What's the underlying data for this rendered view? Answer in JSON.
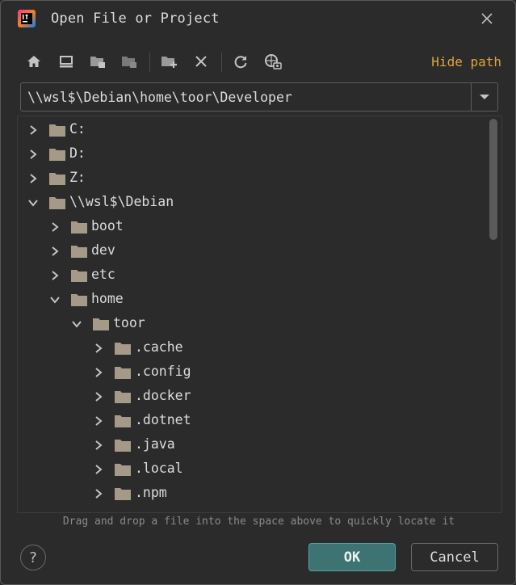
{
  "window": {
    "title": "Open File or Project"
  },
  "toolbar": {
    "buttons": [
      "home-icon",
      "desktop-icon",
      "project-folder-icon",
      "module-folder-icon",
      "new-folder-icon",
      "delete-icon",
      "refresh-icon",
      "show-hidden-icon"
    ],
    "hide_path_label": "Hide path"
  },
  "path": {
    "value": "\\\\wsl$\\Debian\\home\\toor\\Developer"
  },
  "tree": {
    "items": [
      {
        "label": "C:",
        "level": 0,
        "expanded": false
      },
      {
        "label": "D:",
        "level": 0,
        "expanded": false
      },
      {
        "label": "Z:",
        "level": 0,
        "expanded": false
      },
      {
        "label": "\\\\wsl$\\Debian",
        "level": 0,
        "expanded": true
      },
      {
        "label": "boot",
        "level": 1,
        "expanded": false
      },
      {
        "label": "dev",
        "level": 1,
        "expanded": false
      },
      {
        "label": "etc",
        "level": 1,
        "expanded": false
      },
      {
        "label": "home",
        "level": 1,
        "expanded": true
      },
      {
        "label": "toor",
        "level": 2,
        "expanded": true
      },
      {
        "label": ".cache",
        "level": 3,
        "expanded": false
      },
      {
        "label": ".config",
        "level": 3,
        "expanded": false
      },
      {
        "label": ".docker",
        "level": 3,
        "expanded": false
      },
      {
        "label": ".dotnet",
        "level": 3,
        "expanded": false
      },
      {
        "label": ".java",
        "level": 3,
        "expanded": false
      },
      {
        "label": ".local",
        "level": 3,
        "expanded": false
      },
      {
        "label": ".npm",
        "level": 3,
        "expanded": false
      }
    ]
  },
  "hint": "Drag and drop a file into the space above to quickly locate it",
  "buttons": {
    "help": "?",
    "ok": "OK",
    "cancel": "Cancel"
  },
  "colors": {
    "accent": "#e0a63a",
    "ok_bg": "#3e7374",
    "background": "#2b2b2b"
  }
}
